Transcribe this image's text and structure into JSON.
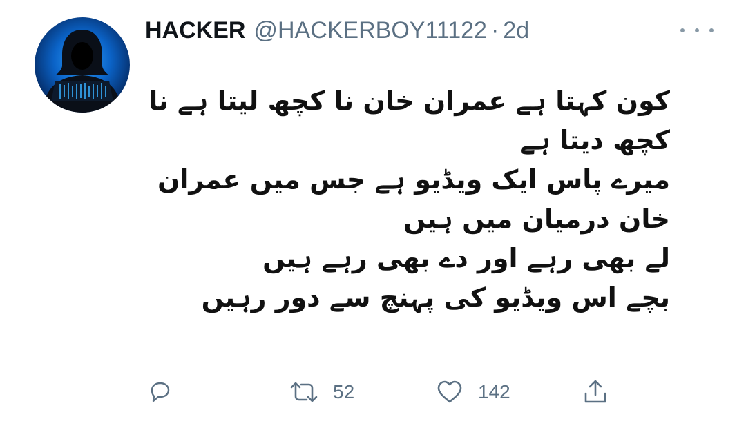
{
  "tweet": {
    "display_name": "HACKER",
    "handle": "@HACKERBOY11122",
    "separator": "·",
    "time": "2d",
    "text_lines": [
      "کون کہتا ہے عمران خان نا کچھ لیتا ہے نا",
      "کچھ دیتا ہے",
      "میرے پاس ایک ویڈیو ہے جس میں عمران",
      "خان درمیان میں ہیں",
      "لے بھی رہے اور دے بھی رہے ہیں",
      "بچے اس ویڈیو کی پہنچ سے دور رہیں"
    ]
  },
  "actions": {
    "reply_icon": "reply-icon",
    "retweet_icon": "retweet-icon",
    "retweet_count": "52",
    "like_icon": "heart-icon",
    "like_count": "142",
    "share_icon": "share-icon"
  },
  "colors": {
    "name": "#0f1419",
    "secondary": "#5b7083",
    "avatar_blue": "#0b63c7"
  }
}
